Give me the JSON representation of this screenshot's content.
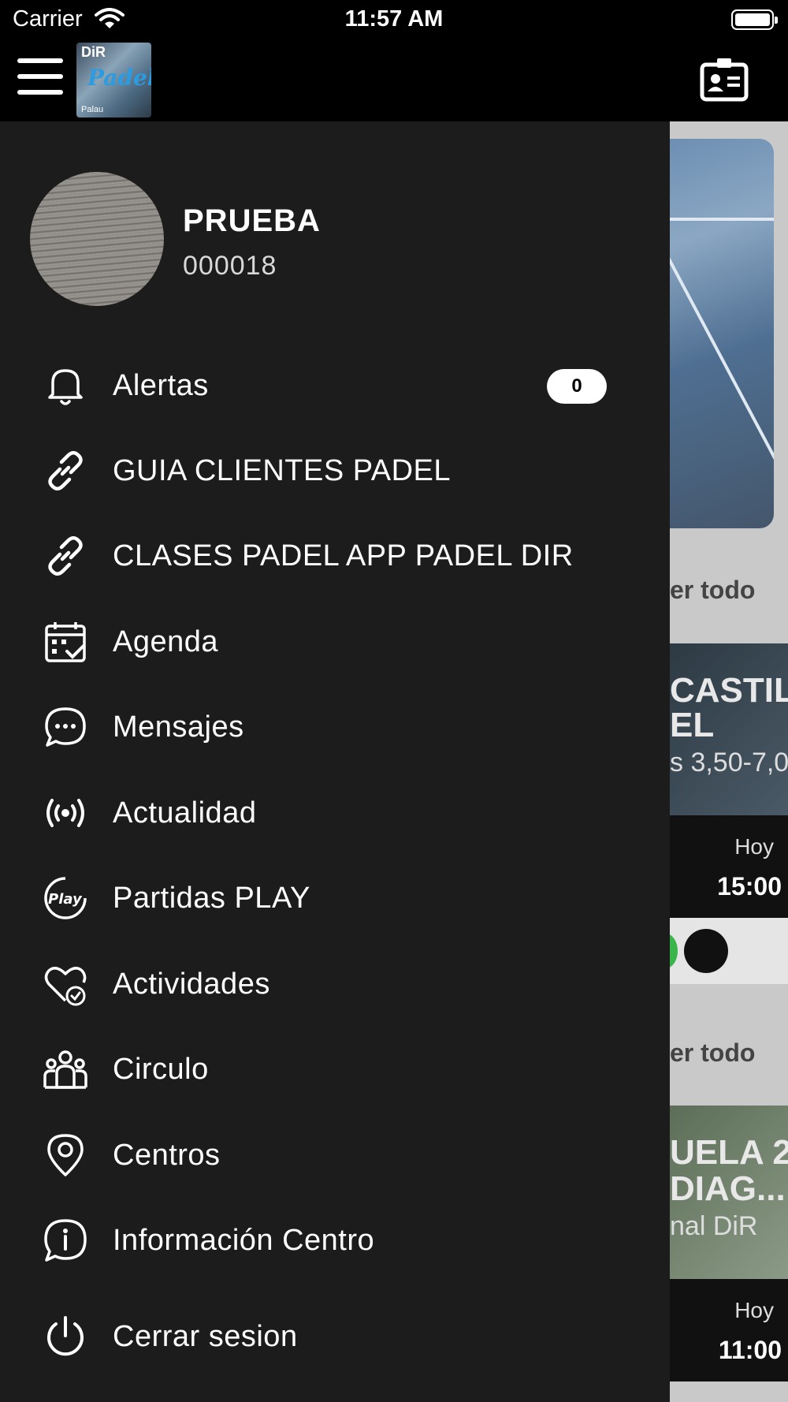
{
  "status_bar": {
    "carrier": "Carrier",
    "time": "11:57 AM"
  },
  "app_bar": {
    "logo": {
      "brand": "DiR",
      "name": "Padel",
      "caption": "Palau"
    }
  },
  "profile": {
    "name": "PRUEBA",
    "member_id": "000018"
  },
  "menu": {
    "items": [
      {
        "label": "Alertas",
        "icon": "bell-icon",
        "badge": "0"
      },
      {
        "label": "GUIA CLIENTES PADEL",
        "icon": "link-icon"
      },
      {
        "label": "CLASES PADEL APP PADEL DIR",
        "icon": "link-icon"
      },
      {
        "label": "Agenda",
        "icon": "calendar-check-icon"
      },
      {
        "label": "Mensajes",
        "icon": "chat-bubble-icon"
      },
      {
        "label": "Actualidad",
        "icon": "broadcast-icon"
      },
      {
        "label": "Partidas PLAY",
        "icon": "play-badge-icon"
      },
      {
        "label": "Actividades",
        "icon": "heart-check-icon"
      },
      {
        "label": "Circulo",
        "icon": "group-icon"
      },
      {
        "label": "Centros",
        "icon": "location-pin-icon"
      },
      {
        "label": "Información Centro",
        "icon": "info-bubble-icon"
      },
      {
        "label": "Cerrar sesion",
        "icon": "power-icon"
      }
    ]
  },
  "background": {
    "ver_todo_1": "er todo",
    "card1_title_1": "CASTIL",
    "card1_title_2": "EL",
    "card1_sub": "s 3,50-7,0",
    "card1_day": "Hoy",
    "card1_time": "15:00",
    "ver_todo_2": "er todo",
    "card2_title_1": "UELA 2",
    "card2_title_2": "DIAG...",
    "card2_sub": "nal DiR",
    "card2_day": "Hoy",
    "card2_time": "11:00"
  },
  "colors": {
    "drawer_bg": "#1c1c1c",
    "bar_bg": "#000000",
    "badge_bg": "#ffffff"
  }
}
